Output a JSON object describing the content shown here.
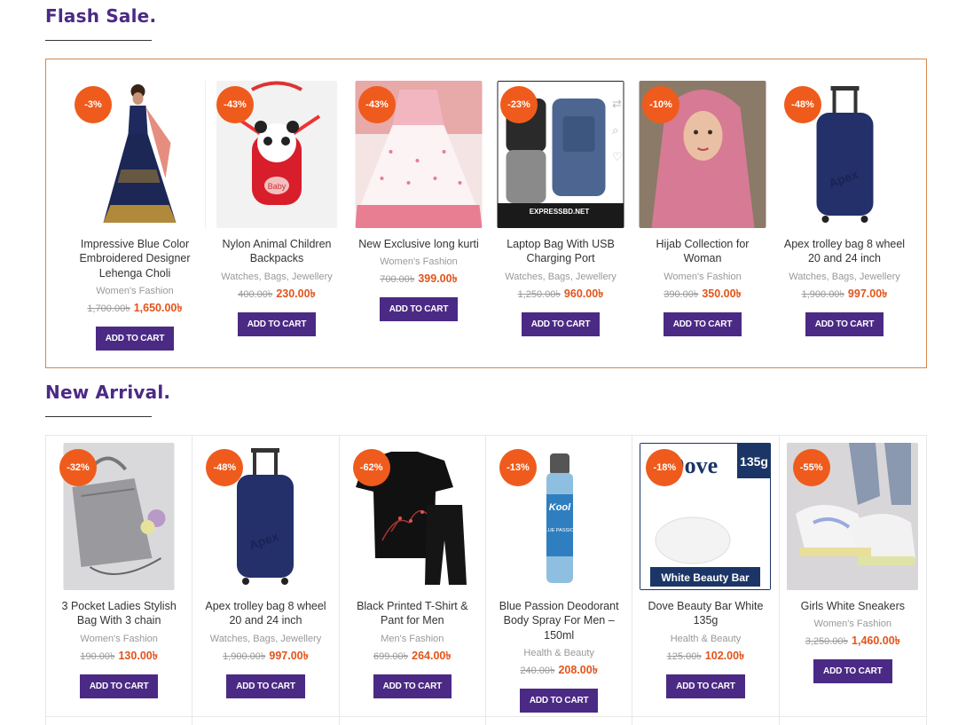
{
  "flash_sale": {
    "title": "Flash Sale.",
    "products": [
      {
        "discount": "-3%",
        "name": "Impressive Blue Color Embroidered Designer Lehenga Choli",
        "category": "Women's Fashion",
        "old_price": "1,700.00৳",
        "price": "1,650.00৳",
        "button": "ADD TO CART"
      },
      {
        "discount": "-43%",
        "name": "Nylon Animal Children Backpacks",
        "category": "Watches, Bags, Jewellery",
        "old_price": "400.00৳",
        "price": "230.00৳",
        "button": "ADD TO CART"
      },
      {
        "discount": "-43%",
        "name": "New Exclusive long kurti",
        "category": "Women's Fashion",
        "old_price": "700.00৳",
        "price": "399.00৳",
        "button": "ADD TO CART"
      },
      {
        "discount": "-23%",
        "name": "Laptop Bag With USB Charging Port",
        "category": "Watches, Bags, Jewellery",
        "old_price": "1,250.00৳",
        "price": "960.00৳",
        "button": "ADD TO CART"
      },
      {
        "discount": "-10%",
        "name": "Hijab Collection for Woman",
        "category": "Women's Fashion",
        "old_price": "390.00৳",
        "price": "350.00৳",
        "button": "ADD TO CART"
      },
      {
        "discount": "-48%",
        "name": "Apex trolley bag 8 wheel 20 and 24 inch",
        "category": "Watches, Bags, Jewellery",
        "old_price": "1,900.00৳",
        "price": "997.00৳",
        "button": "ADD TO CART"
      }
    ]
  },
  "new_arrival": {
    "title": "New Arrival.",
    "products": [
      {
        "discount": "-32%",
        "name": "3 Pocket Ladies Stylish Bag With 3 chain",
        "category": "Women's Fashion",
        "old_price": "190.00৳",
        "price": "130.00৳",
        "button": "ADD TO CART"
      },
      {
        "discount": "-48%",
        "name": "Apex trolley bag 8 wheel 20 and 24 inch",
        "category": "Watches, Bags, Jewellery",
        "old_price": "1,900.00৳",
        "price": "997.00৳",
        "button": "ADD TO CART"
      },
      {
        "discount": "-62%",
        "name": "Black Printed T-Shirt & Pant for Men",
        "category": "Men's Fashion",
        "old_price": "699.00৳",
        "price": "264.00৳",
        "button": "ADD TO CART"
      },
      {
        "discount": "-13%",
        "name": "Blue Passion Deodorant Body Spray For Men – 150ml",
        "category": "Health & Beauty",
        "old_price": "240.00৳",
        "price": "208.00৳",
        "button": "ADD TO CART"
      },
      {
        "discount": "-18%",
        "name": "Dove Beauty Bar White 135g",
        "category": "Health & Beauty",
        "old_price": "125.00৳",
        "price": "102.00৳",
        "button": "ADD TO CART"
      },
      {
        "discount": "-55%",
        "name": "Girls White Sneakers",
        "category": "Women's Fashion",
        "old_price": "3,250.00৳",
        "price": "1,460.00৳",
        "button": "ADD TO CART"
      }
    ]
  },
  "image_text": {
    "laptop_bag_brand": "EXPRESSBD.NET",
    "deodorant_brand": "Kool",
    "deodorant_variant": "BLUE PASSION",
    "dove_brand": "Dove",
    "dove_weight": "135g",
    "dove_label": "White Beauty Bar",
    "backpack_tag": "Baby",
    "trolley_brand": "Apex"
  },
  "colors": {
    "accent_purple": "#4b2a85",
    "badge_orange": "#ef5b1c",
    "price_orange": "#e2541b",
    "flash_border": "#d4874c"
  }
}
